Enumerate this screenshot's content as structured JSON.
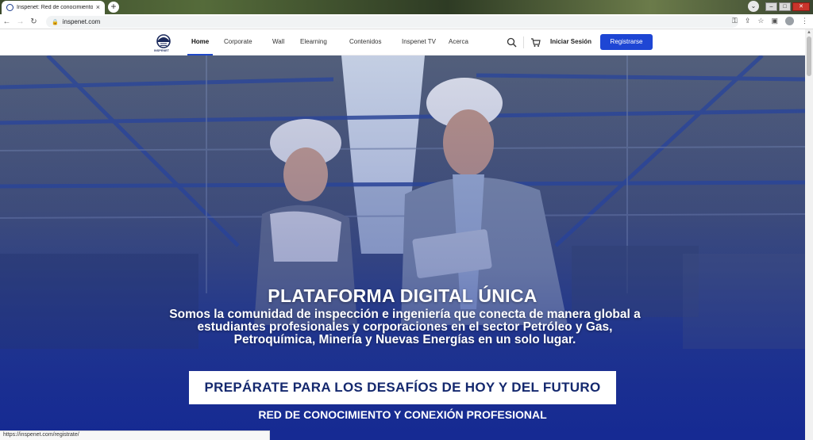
{
  "browser": {
    "tab_title": "Inspenet: Red de conocimiento y",
    "tab_close": "×",
    "new_tab": "+",
    "url": "inspenet.com",
    "status_url": "https://inspenet.com/registrate/",
    "win_min": "–",
    "win_max": "□",
    "win_close": "✕"
  },
  "site": {
    "logo_text": "INSPENET",
    "nav": [
      {
        "label": "Home"
      },
      {
        "label": "Corporate"
      },
      {
        "label": "Wall"
      },
      {
        "label": "Elearning"
      },
      {
        "label": "Contenidos"
      },
      {
        "label": "Inspenet TV"
      },
      {
        "label": "Acerca"
      }
    ],
    "login_label": "Iniciar Sesión",
    "register_label": "Registrarse",
    "accent_color": "#1e46d4"
  },
  "hero": {
    "title": "PLATAFORMA DIGITAL ÚNICA",
    "description": "Somos la comunidad de inspección e ingeniería que conecta de manera global a estudiantes profesionales y corporaciones en el sector Petróleo y Gas, Petroquímica, Minería y Nuevas Energías en un solo lugar.",
    "cta": "PREPÁRATE PARA LOS DESAFÍOS DE HOY Y DEL FUTURO",
    "subtitle": "RED DE CONOCIMIENTO Y CONEXIÓN PROFESIONAL"
  },
  "icons": {
    "search": "search-icon",
    "cart": "cart-icon",
    "lock": "lock-icon",
    "back": "back-arrow-icon",
    "forward": "forward-arrow-icon",
    "reload": "reload-icon"
  }
}
